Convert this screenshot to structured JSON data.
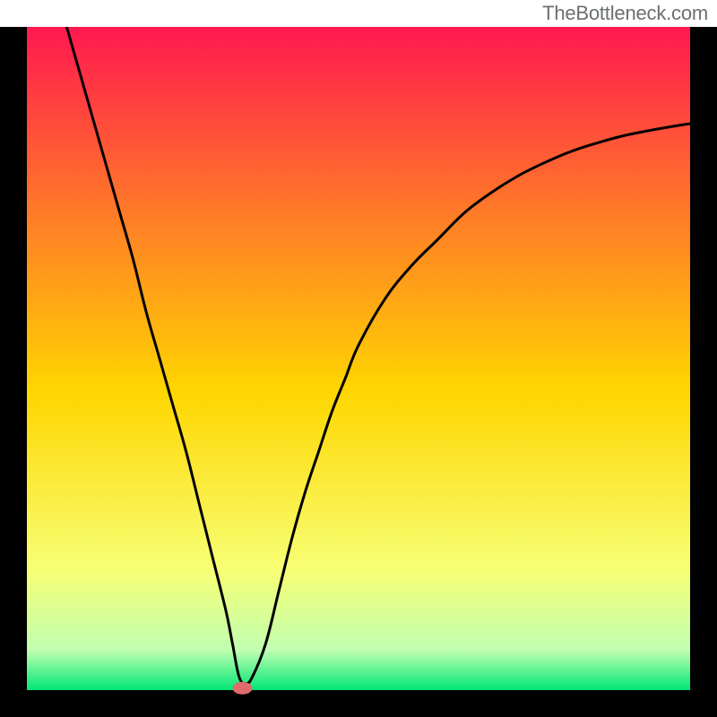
{
  "watermark": "TheBottleneck.com",
  "chart_data": {
    "type": "line",
    "title": "",
    "xlabel": "",
    "ylabel": "",
    "xlim": [
      0,
      100
    ],
    "ylim": [
      0,
      100
    ],
    "grid": false,
    "background_gradient": {
      "top": "#ff1850",
      "q1": "#ff7a28",
      "mid": "#ffd600",
      "q3": "#f7ff75",
      "low": "#c0ffb0",
      "bottom": "#00e676"
    },
    "series": [
      {
        "name": "curve",
        "color": "#000000",
        "x": [
          6,
          8,
          10,
          12,
          14,
          16,
          18,
          20,
          22,
          24,
          26,
          28,
          30,
          31,
          32,
          33,
          34,
          36,
          38,
          40,
          42,
          44,
          46,
          48,
          50,
          54,
          58,
          62,
          66,
          70,
          74,
          78,
          82,
          86,
          90,
          94,
          98,
          100
        ],
        "values": [
          100,
          93,
          86,
          79,
          72,
          65,
          57,
          50,
          43,
          36,
          28,
          20,
          12,
          7,
          2,
          1,
          2,
          7,
          15,
          23,
          30,
          36,
          42,
          47,
          52,
          59,
          64,
          68,
          72,
          75,
          77.5,
          79.5,
          81.2,
          82.5,
          83.6,
          84.4,
          85.1,
          85.4
        ]
      }
    ],
    "marker": {
      "x": 32.5,
      "y": 0.3,
      "color": "#e06b6b"
    }
  }
}
